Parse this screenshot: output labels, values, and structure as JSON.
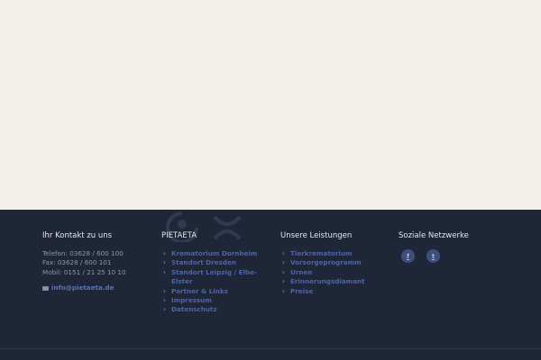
{
  "contact": {
    "title": "Ihr Kontakt zu uns",
    "phone": "Telefon: 03628 / 600 100",
    "fax": "Fax: 03628 / 600 101",
    "mobile": "Mobil: 0151 / 21 25 10 10",
    "email": "info@pietaeta.de",
    "email_icon": "envelope-icon"
  },
  "pietaeta": {
    "title": "PIETAETA",
    "links": [
      {
        "label": "Krematorium Dornheim"
      },
      {
        "label": "Standort Dresden"
      },
      {
        "label": "Standort Leipzig / Elbe-Elster"
      },
      {
        "label": "Partner & Links"
      },
      {
        "label": "Impressum"
      },
      {
        "label": "Datenschutz"
      }
    ]
  },
  "services": {
    "title": "Unsere Leistungen",
    "links": [
      {
        "label": "Tierkrematorium"
      },
      {
        "label": "Vorsorgeprogramm"
      },
      {
        "label": "Urnen"
      },
      {
        "label": "Erinnerungsdiamant"
      },
      {
        "label": "Preise"
      }
    ]
  },
  "social": {
    "title": "Soziale Netzwerke",
    "items": [
      {
        "icon": "facebook-icon",
        "glyph": "f"
      },
      {
        "icon": "twitter-icon",
        "glyph": "t"
      }
    ]
  },
  "colors": {
    "page_background": "#f2efe8",
    "footer_background": "#1f2638",
    "link": "#4d65a6",
    "social_circle": "#3c4f7d"
  }
}
